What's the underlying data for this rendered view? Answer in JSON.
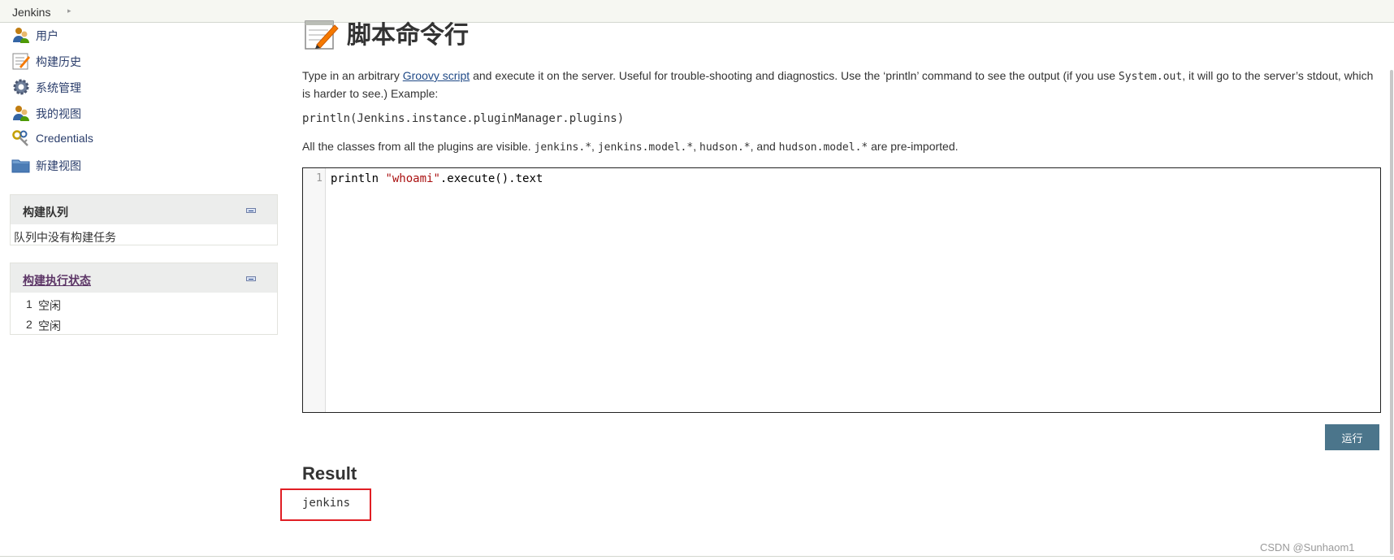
{
  "breadcrumb": {
    "root": "Jenkins"
  },
  "sidebar": {
    "tasks": [
      {
        "label": "用户",
        "icon": "people-icon"
      },
      {
        "label": "构建历史",
        "icon": "notepad-icon"
      },
      {
        "label": "系统管理",
        "icon": "gear-icon"
      },
      {
        "label": "我的视图",
        "icon": "people-icon"
      },
      {
        "label": "Credentials",
        "icon": "keys-icon"
      },
      {
        "label": "新建视图",
        "icon": "folder-icon"
      }
    ],
    "build_queue": {
      "title": "构建队列",
      "empty_text": "队列中没有构建任务"
    },
    "executors": {
      "title": "构建执行状态",
      "items": [
        {
          "number": "1",
          "status": "空闲"
        },
        {
          "number": "2",
          "status": "空闲"
        }
      ]
    }
  },
  "main": {
    "title": "脚本命令行",
    "description": {
      "before_link": "Type in an arbitrary ",
      "link": "Groovy script",
      "after_link": " and execute it on the server. Useful for trouble-shooting and diagnostics. Use the ‘println’ command to see the output (if you use ",
      "code": "System.out",
      "after_code": ", it will go to the server’s stdout, which is harder to see.) Example:"
    },
    "example": "println(Jenkins.instance.pluginManager.plugins)",
    "imports": {
      "p1": "All the classes from all the plugins are visible. ",
      "c1": "jenkins.*",
      "s1": ", ",
      "c2": "jenkins.model.*",
      "s2": ", ",
      "c3": "hudson.*",
      "s3": ", and ",
      "c4": "hudson.model.*",
      "p2": " are pre-imported."
    },
    "editor": {
      "line_number": "1",
      "code_prefix": "println ",
      "code_string": "\"whoami\"",
      "code_suffix": ".execute().text"
    },
    "run_label": "运行",
    "result_title": "Result",
    "result_output": "jenkins"
  },
  "watermark": "CSDN @Sunhaom1"
}
